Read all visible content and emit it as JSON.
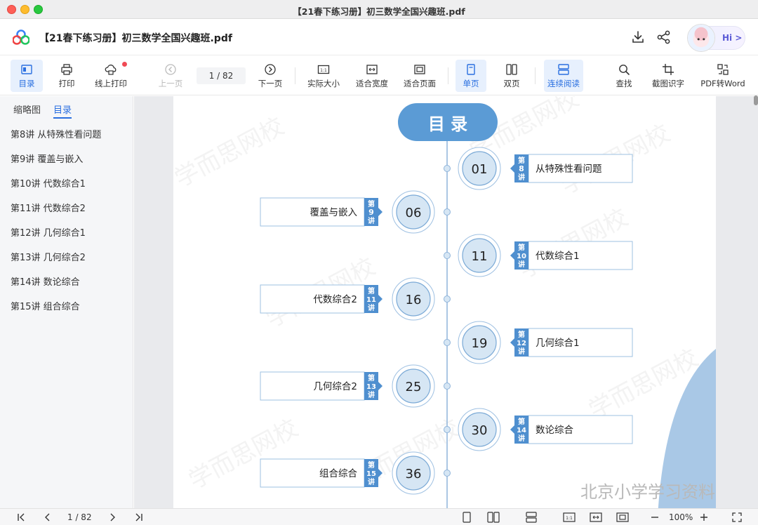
{
  "window": {
    "title": "【21春下练习册】初三数学全国兴趣班.pdf"
  },
  "header": {
    "doc_title": "【21春下练习册】初三数学全国兴趣班.pdf",
    "hi_label": "Hi >"
  },
  "toolbar": {
    "toc": "目录",
    "print": "打印",
    "online_print": "线上打印",
    "prev_page": "上一页",
    "page_indicator": "1  /  82",
    "next_page": "下一页",
    "actual_size": "实际大小",
    "fit_width": "适合宽度",
    "fit_page": "适合页面",
    "single_page": "单页",
    "double_page": "双页",
    "continuous": "连续阅读",
    "search": "查找",
    "ocr": "截图识字",
    "pdf_to_word": "PDF转Word"
  },
  "sidebar": {
    "tabs": [
      {
        "label": "缩略图"
      },
      {
        "label": "目录"
      }
    ],
    "items": [
      {
        "label": "第8讲 从特殊性看问题"
      },
      {
        "label": "第9讲 覆盖与嵌入"
      },
      {
        "label": "第10讲 代数综合1"
      },
      {
        "label": "第11讲 代数综合2"
      },
      {
        "label": "第12讲 几何综合1"
      },
      {
        "label": "第13讲 几何综合2"
      },
      {
        "label": "第14讲 数论综合"
      },
      {
        "label": "第15讲 组合综合"
      }
    ]
  },
  "page": {
    "heading": "目 录",
    "watermark": "学而思网校",
    "footer_watermark": "北京小学学习资料",
    "entries": [
      {
        "num": "01",
        "lecture": "8",
        "title": "从特殊性看问题",
        "side": "right"
      },
      {
        "num": "06",
        "lecture": "9",
        "title": "覆盖与嵌入",
        "side": "left"
      },
      {
        "num": "11",
        "lecture": "10",
        "title": "代数综合1",
        "side": "right"
      },
      {
        "num": "16",
        "lecture": "11",
        "title": "代数综合2",
        "side": "left"
      },
      {
        "num": "19",
        "lecture": "12",
        "title": "几何综合1",
        "side": "right"
      },
      {
        "num": "25",
        "lecture": "13",
        "title": "几何综合2",
        "side": "left"
      },
      {
        "num": "30",
        "lecture": "14",
        "title": "数论综合",
        "side": "right"
      },
      {
        "num": "36",
        "lecture": "15",
        "title": "组合综合",
        "side": "left"
      }
    ],
    "badge_top": "第",
    "badge_bottom": "讲"
  },
  "bottombar": {
    "page_indicator": "1  /  82",
    "zoom": "100%"
  },
  "colors": {
    "accent": "#2a6fe0",
    "toc_blue": "#5b9bd5",
    "badge_blue": "#4f8fcf",
    "circle_fill": "#d6e6f4"
  }
}
